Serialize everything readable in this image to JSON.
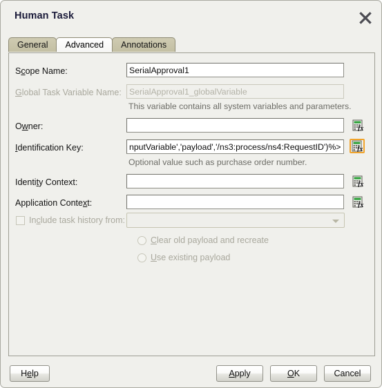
{
  "dialog": {
    "title": "Human Task",
    "close_icon": "close-icon"
  },
  "tabs": [
    {
      "label": "General",
      "active": false
    },
    {
      "label": "Advanced",
      "active": true
    },
    {
      "label": "Annotations",
      "active": false
    }
  ],
  "form": {
    "scope_name": {
      "label_pre": "S",
      "label_mn": "c",
      "label_post": "ope Name:",
      "value": "SerialApproval1"
    },
    "global_task_variable": {
      "label_pre": "",
      "label_mn": "G",
      "label_post": "lobal Task Variable Name:",
      "value": "SerialApproval1_globalVariable",
      "hint": "This variable contains all system variables and parameters."
    },
    "owner": {
      "label_pre": "O",
      "label_mn": "w",
      "label_post": "ner:",
      "value": "",
      "fx_icon": "expression-builder-icon"
    },
    "identification_key": {
      "label_pre": "",
      "label_mn": "I",
      "label_post": "dentification Key:",
      "value": "nputVariable','payload','/ns3:process/ns4:RequestID')%>",
      "hint": "Optional value such as purchase order number.",
      "fx_icon": "expression-builder-icon"
    },
    "identity_context": {
      "label_pre": "Identi",
      "label_mn": "t",
      "label_post": "y Context:",
      "value": "",
      "fx_icon": "expression-builder-icon"
    },
    "application_context": {
      "label_pre": "Application Conte",
      "label_mn": "x",
      "label_post": "t:",
      "value": "",
      "fx_icon": "expression-builder-icon"
    },
    "include_task_history": {
      "label_pre": "In",
      "label_mn": "c",
      "label_post": "lude task history from:",
      "checked": false,
      "disabled": true,
      "combo_value": ""
    },
    "payload_options": [
      {
        "label_pre": "",
        "label_mn": "C",
        "label_post": "lear old payload and recreate",
        "selected": false,
        "disabled": true
      },
      {
        "label_pre": "",
        "label_mn": "U",
        "label_post": "se existing payload",
        "selected": false,
        "disabled": true
      }
    ]
  },
  "buttons": {
    "help": {
      "pre": "H",
      "mn": "e",
      "post": "lp"
    },
    "apply": {
      "pre": "",
      "mn": "A",
      "post": "pply"
    },
    "ok": {
      "pre": "",
      "mn": "O",
      "post": "K"
    },
    "cancel": {
      "pre": "",
      "mn": "",
      "post": "Cancel"
    }
  },
  "colors": {
    "dialog_bg": "#f0f0ec",
    "tab_inactive": "#c9c5aa",
    "tab_active": "#fafafa",
    "focus_highlight": "#f0a32a",
    "disabled_text": "#a9a89d",
    "hint_text": "#6c6c66",
    "title_text": "#1b1b3a"
  }
}
